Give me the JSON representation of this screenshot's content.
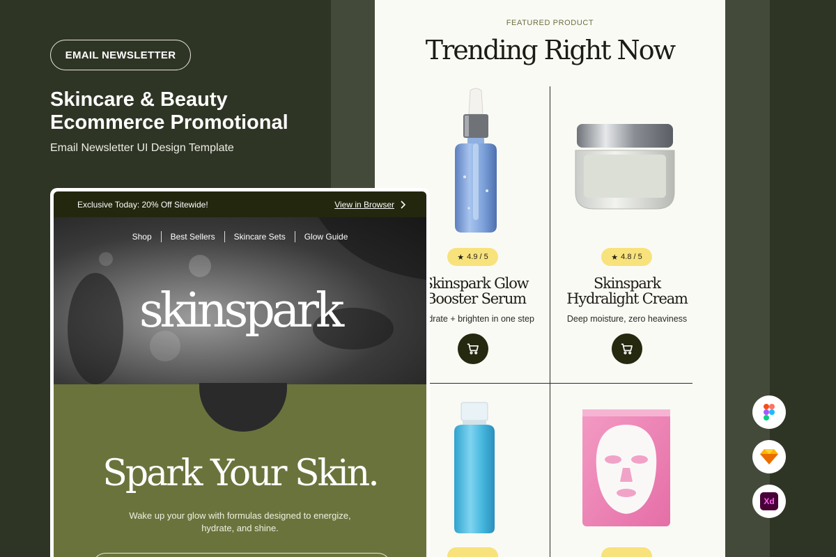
{
  "promo": {
    "tag": "EMAIL NEWSLETTER",
    "headline_line1": "Skincare & Beauty",
    "headline_line2": "Ecommerce Promotional",
    "subtitle": "Email Newsletter UI Design Template"
  },
  "email_hero": {
    "announcement": "Exclusive Today: 20% Off Sitewide!",
    "view_in_browser": "View in Browser",
    "nav": [
      "Shop",
      "Best Sellers",
      "Skincare Sets",
      "Glow Guide"
    ],
    "brand": "skinspark",
    "tagline": "Spark Your Skin.",
    "lede": "Wake up your glow with formulas designed to energize, hydrate, and shine."
  },
  "featured": {
    "eyebrow": "FEATURED PRODUCT",
    "title": "Trending Right Now",
    "products": [
      {
        "rating": "4.9 / 5",
        "name_line1": "Skinspark Glow",
        "name_line2": "Booster Serum",
        "desc": "Hydrate + brighten in one step"
      },
      {
        "rating": "4.8 / 5",
        "name_line1": "Skinspark",
        "name_line2": "Hydralight Cream",
        "desc": "Deep moisture, zero heaviness"
      }
    ]
  },
  "apps": [
    "figma-icon",
    "sketch-icon",
    "adobe-xd-icon"
  ],
  "colors": {
    "background_dark": "#2f3525",
    "background_mid": "#434a3a",
    "olive": "#6b733c",
    "topbar": "#22270e",
    "rating_yellow": "#f8e27c",
    "cart_button": "#24290f"
  }
}
